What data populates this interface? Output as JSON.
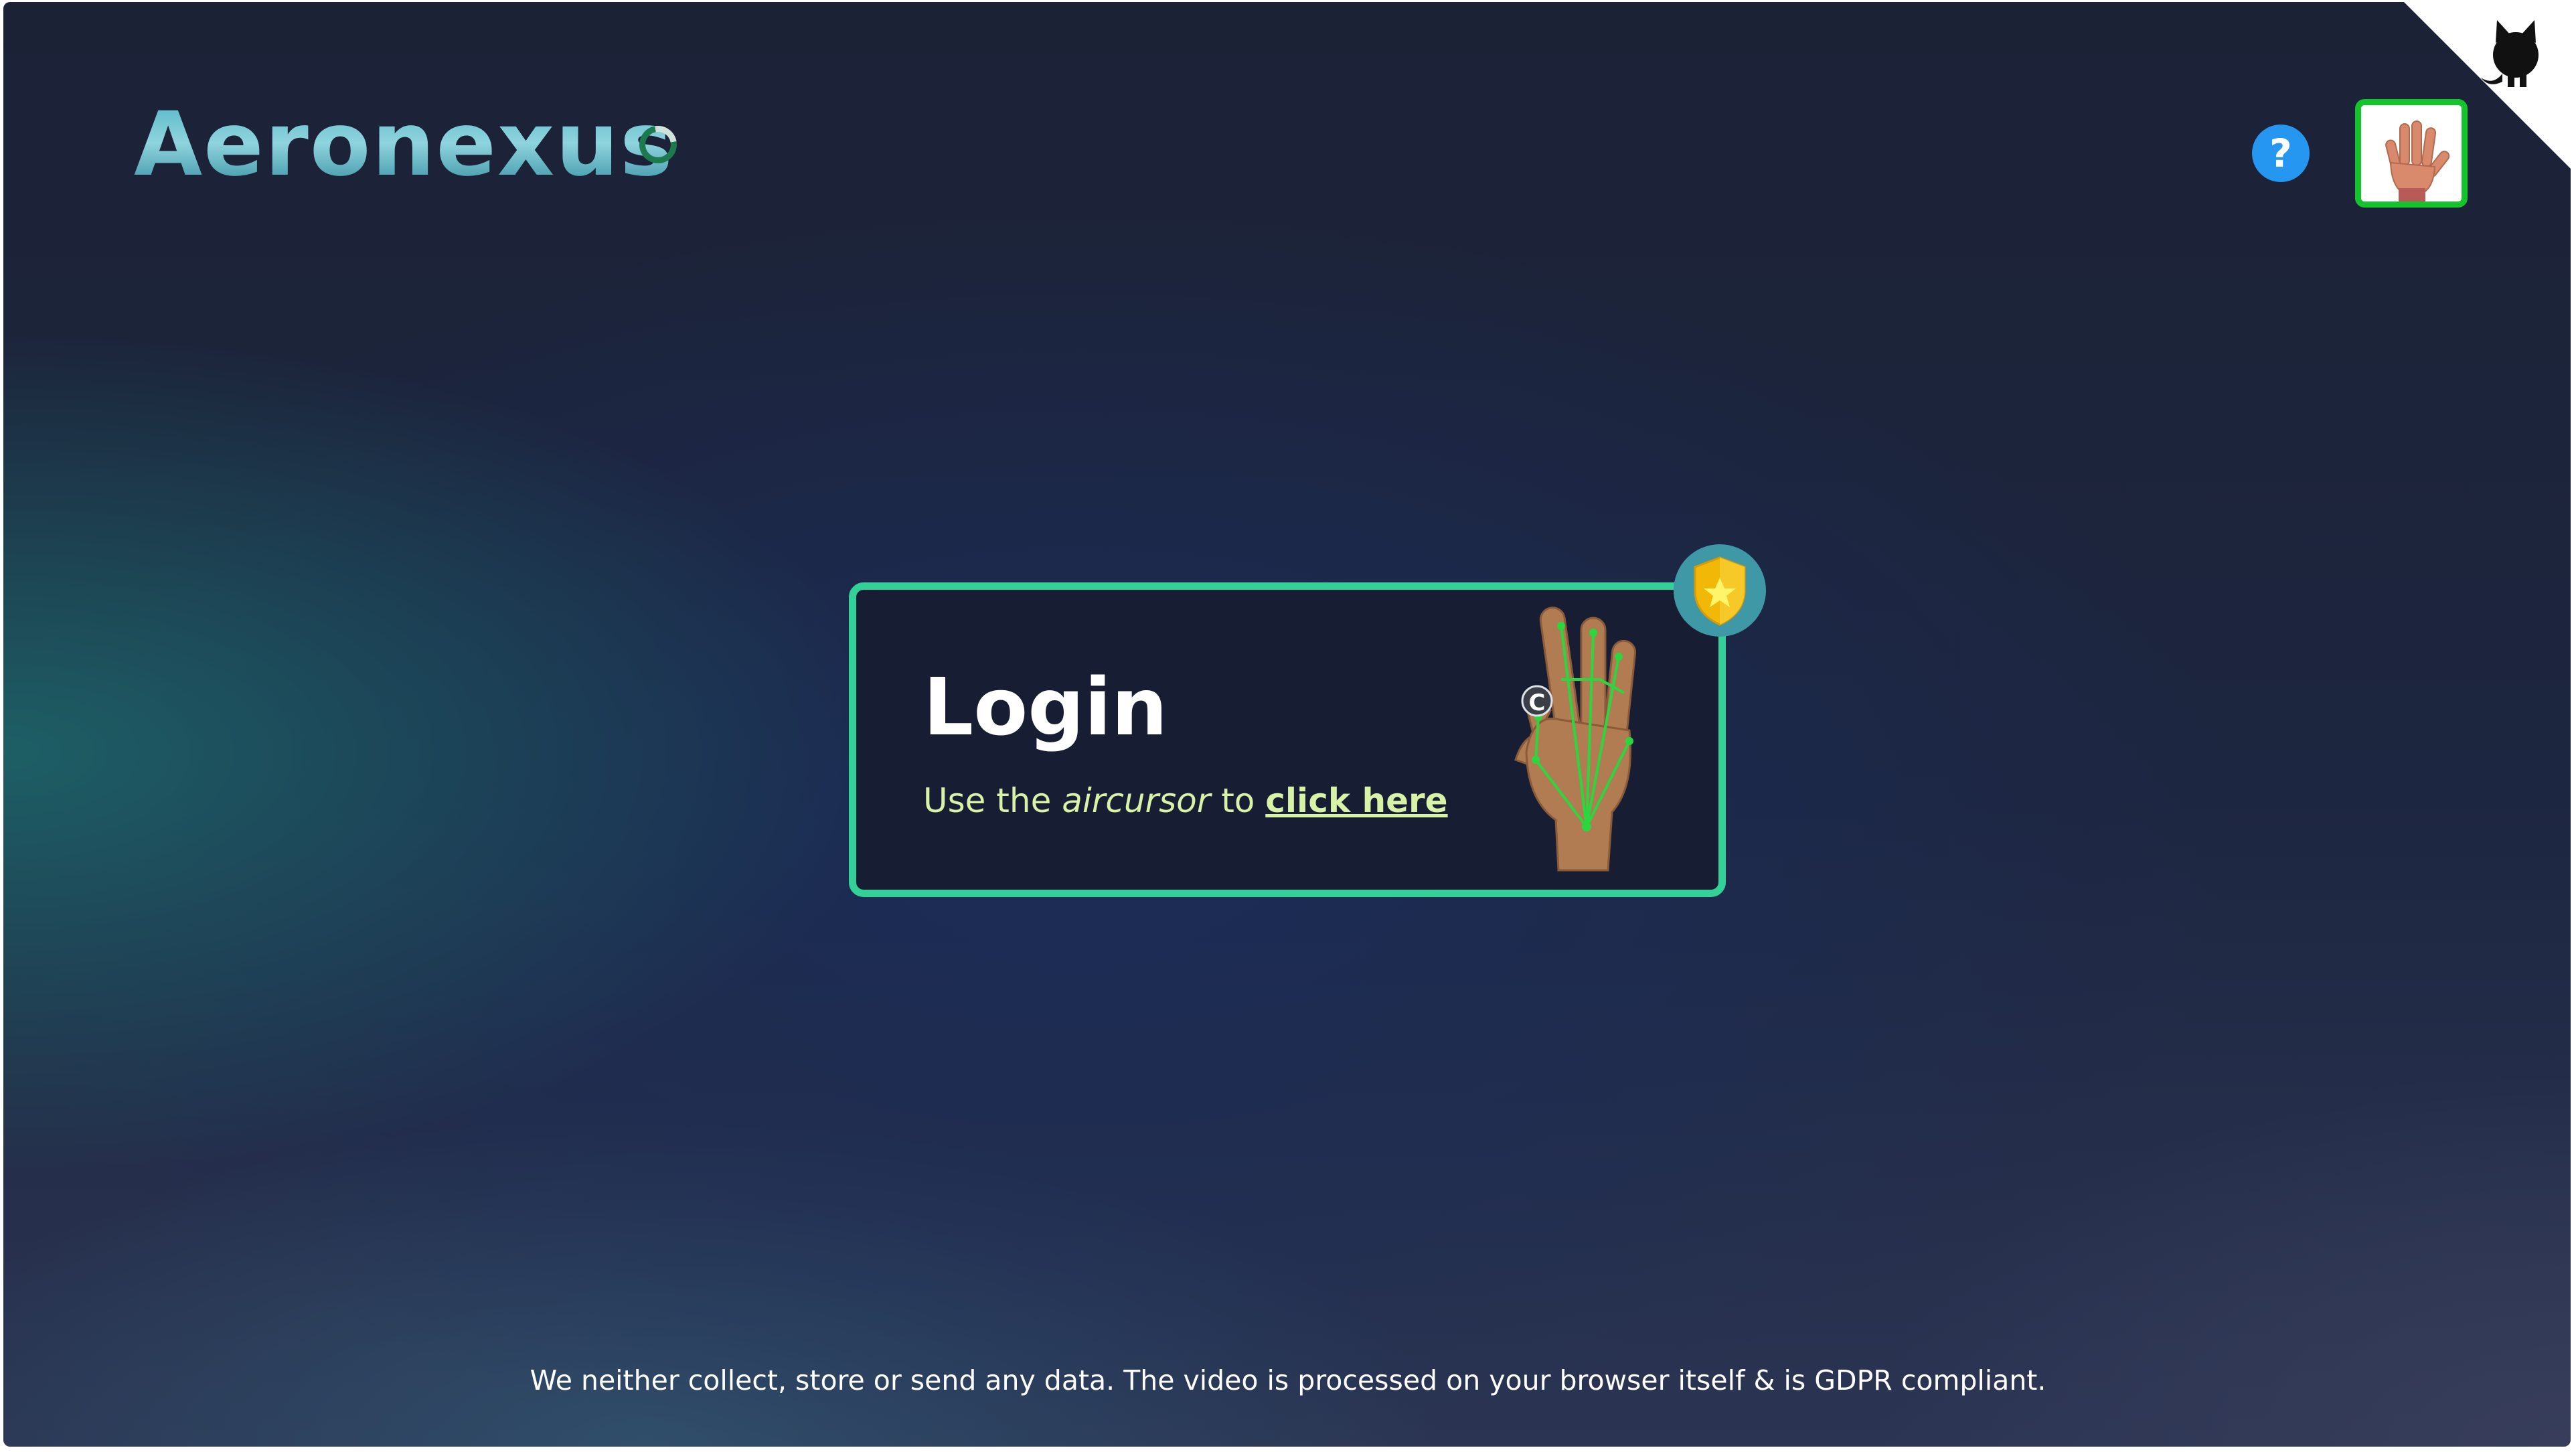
{
  "header": {
    "logo_text": "Aeronexus",
    "help_label": "?"
  },
  "login_card": {
    "title": "Login",
    "subtitle_prefix": "Use the ",
    "subtitle_em": "aircursor",
    "subtitle_mid": " to ",
    "subtitle_link": "click here",
    "cursor_glyph": "C"
  },
  "footer": {
    "privacy_text": "We neither collect, store or send any data. The video is processed on your browser itself & is GDPR compliant."
  },
  "colors": {
    "accent_green": "#33d198",
    "help_blue": "#2697f0",
    "camera_border": "#15c32c",
    "subtitle": "#d8f3a8"
  },
  "icons": [
    "loading-spinner-icon",
    "help-icon",
    "open-palm-icon",
    "github-corner-icon",
    "shield-star-icon",
    "ok-hand-gesture-icon"
  ]
}
